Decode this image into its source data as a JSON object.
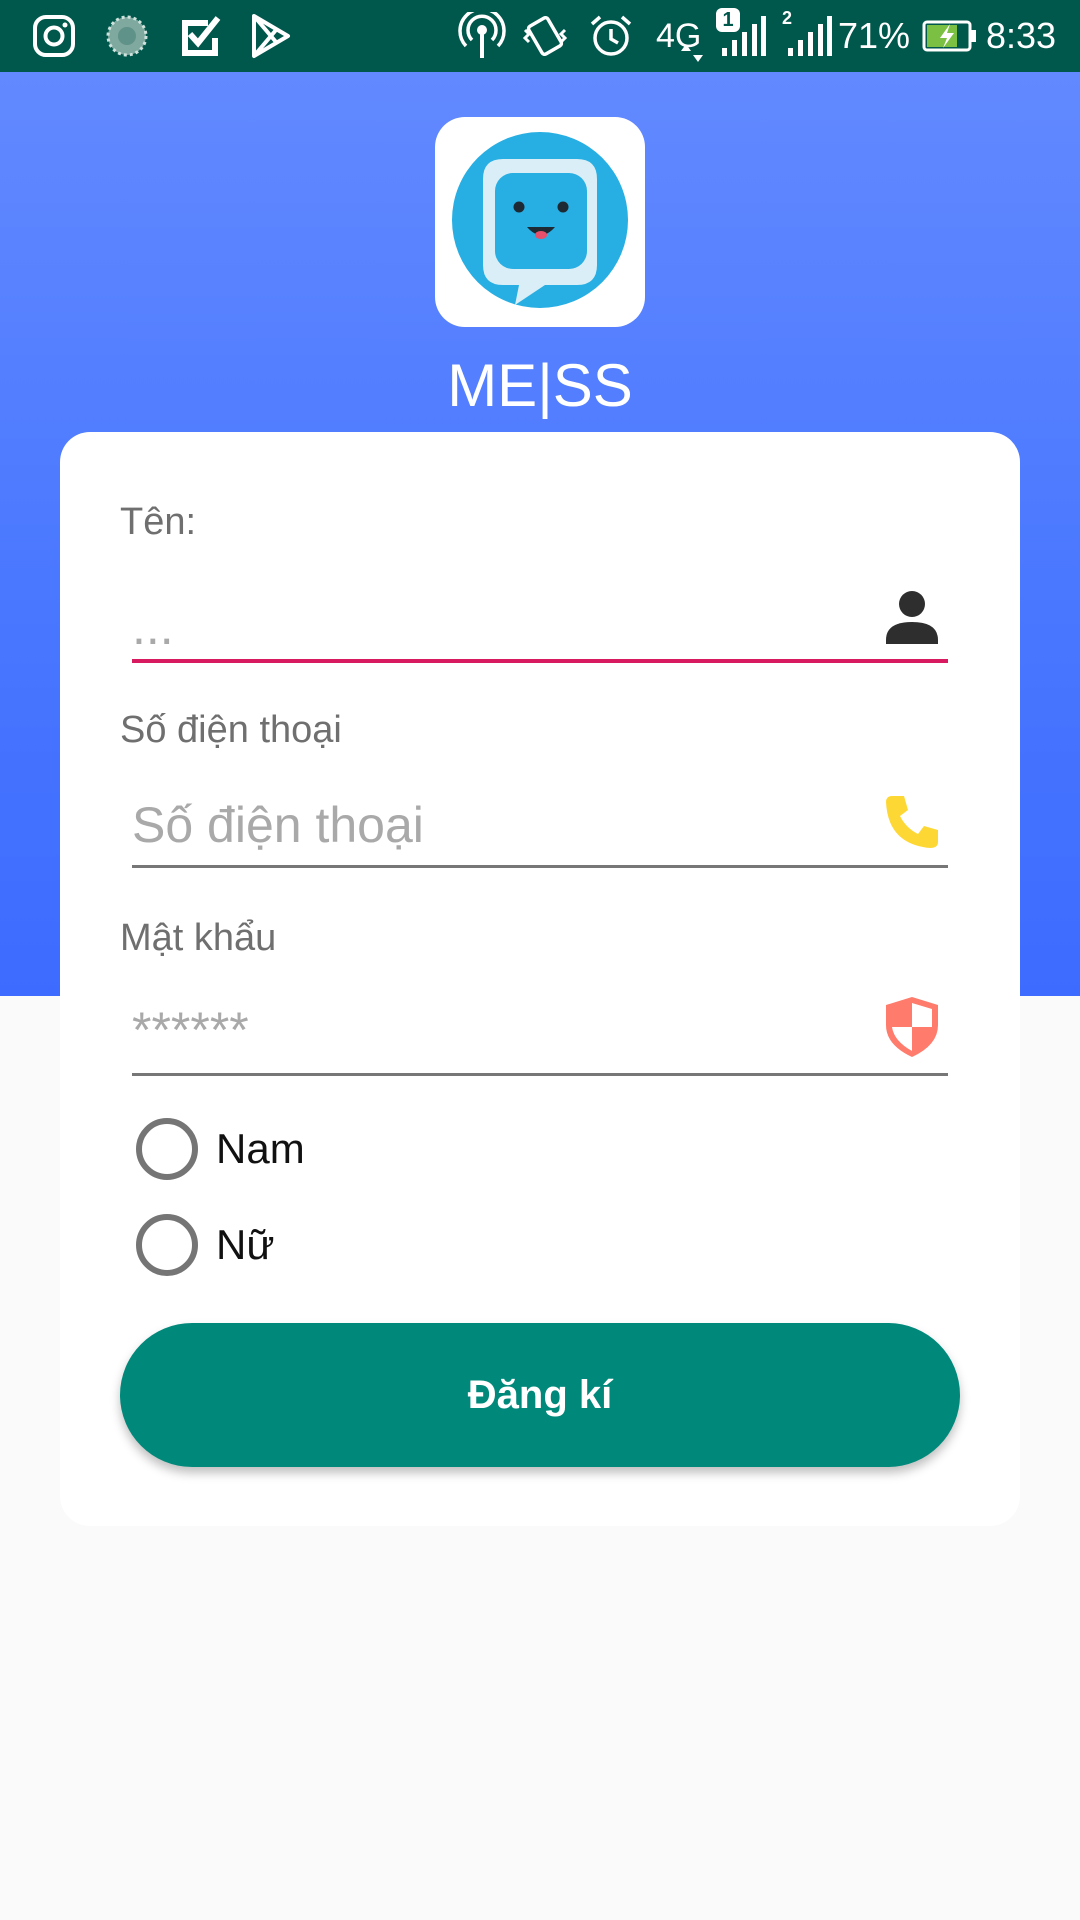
{
  "status_bar": {
    "icons": [
      "instagram-icon",
      "loading-icon",
      "checkbox-app-icon",
      "play-store-icon",
      "hotspot-icon",
      "vibrate-icon",
      "alarm-icon",
      "network-4g-icon",
      "signal-sim1-icon",
      "signal-sim2-icon",
      "battery-charging-icon"
    ],
    "network_type": "4G",
    "sim1_badge": "1",
    "sim2_badge": "2",
    "battery_percent": "71%",
    "time": "8:33"
  },
  "app": {
    "name": "ME|SS",
    "logo_icon": "chat-bubble-face-icon"
  },
  "form": {
    "name_field": {
      "label": "Tên:",
      "placeholder": "...",
      "value": "",
      "icon": "person-icon"
    },
    "phone_field": {
      "label": "Số điện thoại",
      "placeholder": "Số điện thoại",
      "value": "",
      "icon": "phone-icon"
    },
    "password_field": {
      "label": "Mật khẩu",
      "placeholder": "******",
      "value": "",
      "icon": "shield-icon"
    },
    "gender_options": [
      {
        "label": "Nam",
        "checked": false
      },
      {
        "label": "Nữ",
        "checked": false
      }
    ],
    "submit_label": "Đăng kí"
  },
  "colors": {
    "status_bar": "#00574b",
    "header_gradient_top": "#6289ff",
    "header_gradient_bottom": "#3d6bff",
    "focused_underline": "#d81b60",
    "submit_button": "#00897b",
    "phone_icon": "#fdd835",
    "shield_icon": "#ff7b6b"
  }
}
